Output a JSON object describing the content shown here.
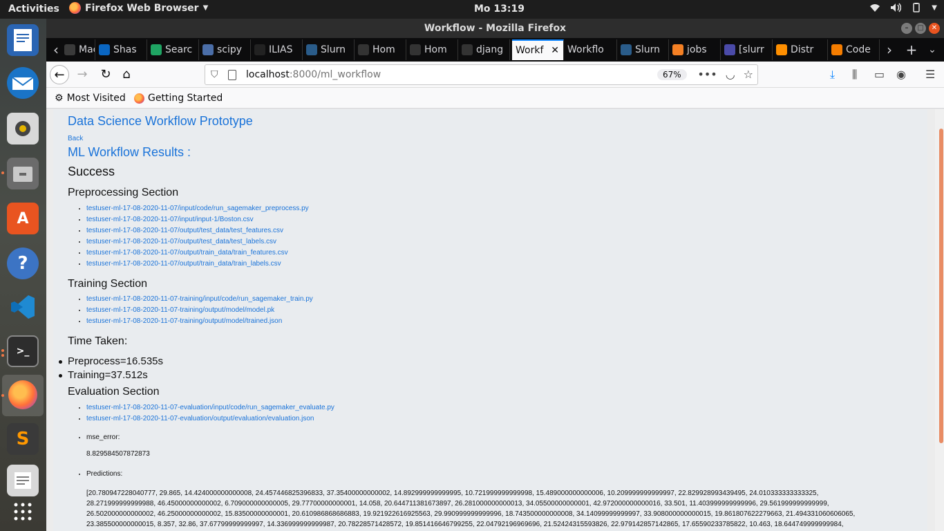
{
  "topbar": {
    "activities": "Activities",
    "app_name": "Firefox Web Browser",
    "clock": "Mo 13:19"
  },
  "window": {
    "title": "Workflow - Mozilla Firefox"
  },
  "tabs": [
    {
      "label": "Mach",
      "icon": "page-icon",
      "color": "#3a3a3a"
    },
    {
      "label": "Shas",
      "icon": "linkedin-icon",
      "color": "#0a66c2"
    },
    {
      "label": "Searc",
      "icon": "google-drive-icon",
      "color": "#1fa463"
    },
    {
      "label": "scipy",
      "icon": "scipy-icon",
      "color": "#4b6ea8"
    },
    {
      "label": "ILIAS",
      "icon": "ilias-icon",
      "color": "#222"
    },
    {
      "label": "Slurn",
      "icon": "slurm-icon",
      "color": "#2a5c8a"
    },
    {
      "label": "Hom",
      "icon": "github-icon",
      "color": "#333"
    },
    {
      "label": "Hom",
      "icon": "github-icon",
      "color": "#333"
    },
    {
      "label": "djang",
      "icon": "github-icon",
      "color": "#333"
    },
    {
      "label": "Workf",
      "icon": "none",
      "color": "#f9f9fa",
      "active": true
    },
    {
      "label": "Workflo",
      "icon": "none",
      "color": "#0c0c0d"
    },
    {
      "label": "Slurn",
      "icon": "slurm-icon",
      "color": "#2a5c8a"
    },
    {
      "label": "jobs",
      "icon": "stackoverflow-icon",
      "color": "#f48024"
    },
    {
      "label": "[slurr",
      "icon": "discourse-icon",
      "color": "#4a4aa8"
    },
    {
      "label": "Distr",
      "icon": "tensorflow-icon",
      "color": "#ff8f00"
    },
    {
      "label": "Code",
      "icon": "blogger-icon",
      "color": "#f57d00"
    }
  ],
  "navbar": {
    "url_host": "localhost",
    "url_path": ":8000/ml_workflow",
    "zoom": "67%"
  },
  "bookmarks": {
    "most_visited": "Most Visited",
    "getting_started": "Getting Started"
  },
  "page": {
    "title": "Data Science Workflow Prototype",
    "back": "Back",
    "results_heading": "ML Workflow Results :",
    "status": "Success",
    "preprocessing": {
      "heading": "Preprocessing Section",
      "links": [
        "testuser-ml-17-08-2020-11-07/input/code/run_sagemaker_preprocess.py",
        "testuser-ml-17-08-2020-11-07/input/input-1/Boston.csv",
        "testuser-ml-17-08-2020-11-07/output/test_data/test_features.csv",
        "testuser-ml-17-08-2020-11-07/output/test_data/test_labels.csv",
        "testuser-ml-17-08-2020-11-07/output/train_data/train_features.csv",
        "testuser-ml-17-08-2020-11-07/output/train_data/train_labels.csv"
      ]
    },
    "training": {
      "heading": "Training Section",
      "links": [
        "testuser-ml-17-08-2020-11-07-training/input/code/run_sagemaker_train.py",
        "testuser-ml-17-08-2020-11-07-training/output/model/model.pk",
        "testuser-ml-17-08-2020-11-07-training/output/model/trained.json"
      ]
    },
    "time_taken": {
      "heading": "Time Taken:",
      "items": [
        "Preprocess=16.535s",
        "Training=37.512s"
      ]
    },
    "evaluation": {
      "heading": "Evaluation Section",
      "links": [
        "testuser-ml-17-08-2020-11-07-evaluation/input/code/run_sagemaker_evaluate.py",
        "testuser-ml-17-08-2020-11-07-evaluation/output/evaluation/evaluation.json"
      ],
      "mse_label": "mse_error:",
      "mse_value": "8.829584507872873",
      "predictions_label": "Predictions:",
      "predictions_lines": [
        "[20.780947228040777, 29.865, 14.424000000000008, 24.457446825396833, 37.35400000000002, 14.892999999999995, 10.721999999999998, 15.489000000000006, 10.209999999999997, 22.829928993439495, 24.010333333333325,",
        "28.271999999999988, 46.45000000000002, 6.709000000000005, 29.77700000000001, 14.058, 20.644711381673897, 26.281000000000013, 34.05500000000001, 42.972000000000016, 33.501, 11.403999999999996, 29.561999999999999,",
        "26.502000000000002, 46.25000000000002, 15.83500000000001, 20.610986868686883, 19.921922616925563, 29.990999999999996, 18.743500000000008, 34.14099999999997, 33.908000000000015, 19.861807622279663, 21.494331060606065,",
        "23.385500000000015, 8.357, 32.86, 37.67799999999997, 14.336999999999987, 20.78228571428572, 19.851416646799255, 22.04792196969696, 21.52424315593826, 22.979142857142865, 17.65590233785822, 10.463, 18.644749999999984,"
      ]
    }
  }
}
